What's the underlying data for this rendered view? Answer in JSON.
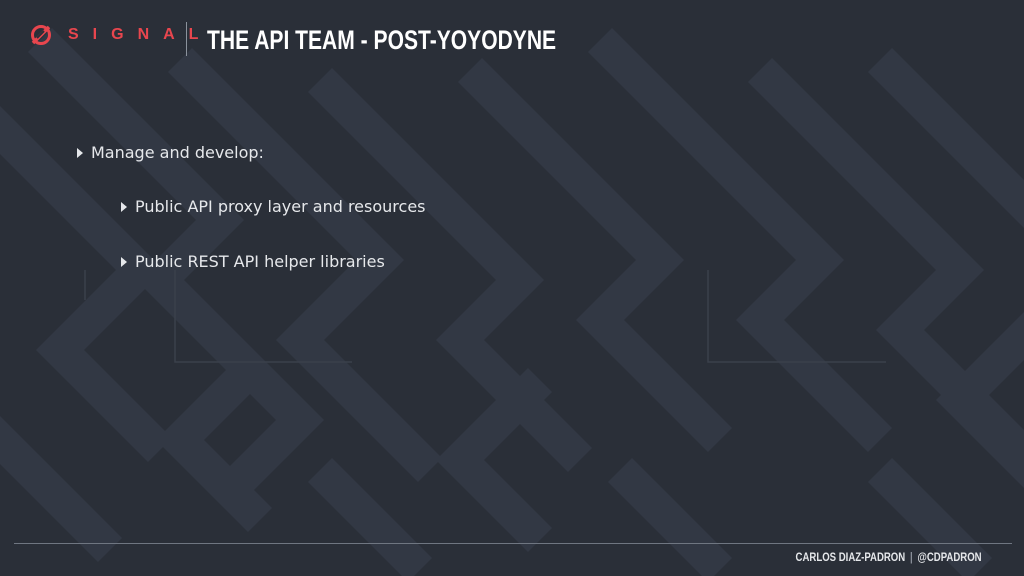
{
  "header": {
    "logo_text": "SIGNAL",
    "title": "THE API TEAM - POST-YOYODYNE"
  },
  "bullets": [
    {
      "label": "Manage and develop:",
      "level": 1
    },
    {
      "label": "Public API proxy layer and resources",
      "level": 2
    },
    {
      "label": "Public REST API helper libraries",
      "level": 2
    }
  ],
  "footer": {
    "author": "CARLOS DIAZ-PADRON",
    "separator": "|",
    "handle": "@CDPADRON"
  },
  "colors": {
    "background": "#2a2f38",
    "pattern": "#323844",
    "brand": "#e8464e",
    "text": "#e6e8eb"
  },
  "icons": [
    "signal-logo-icon",
    "caret-right-icon"
  ]
}
